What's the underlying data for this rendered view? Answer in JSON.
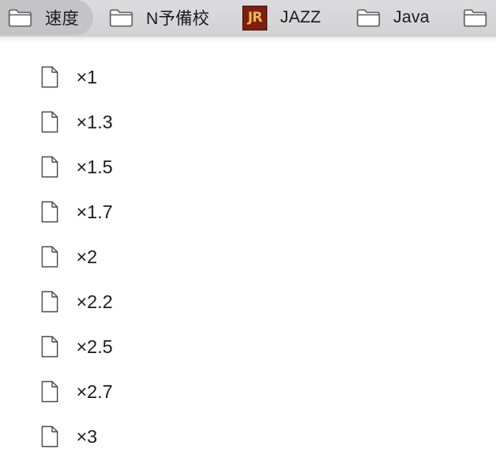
{
  "bookmarks_bar": {
    "items": [
      {
        "label": "速度",
        "icon": "folder-icon",
        "active": true
      },
      {
        "label": "N予備校",
        "icon": "folder-icon",
        "active": false
      },
      {
        "label": "JAZZ",
        "icon": "jr-favicon",
        "favicon_text": "JR",
        "active": false
      },
      {
        "label": "Java",
        "icon": "folder-icon",
        "active": false
      },
      {
        "label": "",
        "icon": "folder-icon",
        "active": false
      }
    ]
  },
  "menu": {
    "items": [
      {
        "label": "×1",
        "icon": "document-icon"
      },
      {
        "label": "×1.3",
        "icon": "document-icon"
      },
      {
        "label": "×1.5",
        "icon": "document-icon"
      },
      {
        "label": "×1.7",
        "icon": "document-icon"
      },
      {
        "label": "×2",
        "icon": "document-icon"
      },
      {
        "label": "×2.2",
        "icon": "document-icon"
      },
      {
        "label": "×2.5",
        "icon": "document-icon"
      },
      {
        "label": "×2.7",
        "icon": "document-icon"
      },
      {
        "label": "×3",
        "icon": "document-icon"
      }
    ]
  },
  "colors": {
    "bar_background": "#d2d2d4",
    "active_pill": "#c4c4c7",
    "jr_favicon_bg": "#7b1f12",
    "jr_favicon_text": "#f0b64a"
  }
}
